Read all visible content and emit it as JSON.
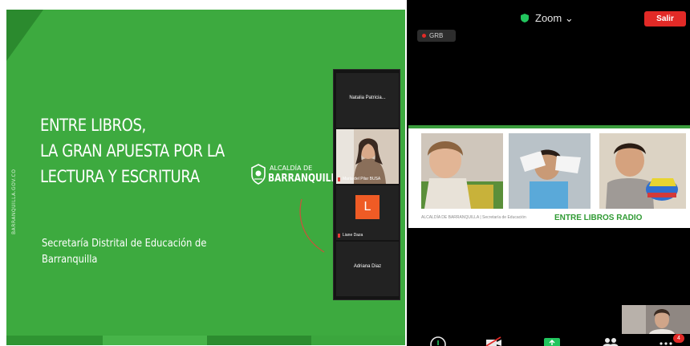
{
  "slide": {
    "vertical_text": "BARRANQUILLA.GOV.CO",
    "title_lines": [
      "ENTRE LIBROS,",
      "LA GRAN APUESTA POR LA",
      "LECTURA Y ESCRITURA"
    ],
    "subtitle_lines": [
      "Secretaría Distrital de Educación de",
      "Barranquilla"
    ],
    "logo_small": "ALCALDÍA DE",
    "logo_big": "BARRANQUILLA",
    "colors": {
      "background": "#3daa3f",
      "corner": "#2b8a2e",
      "text": "#ffffff"
    }
  },
  "participants": {
    "tiles": [
      {
        "name": "Natalia Patricia..."
      },
      {
        "name": "María del Pilar BUSA"
      },
      {
        "name": "Liane Daza",
        "initial": "L"
      },
      {
        "name": "Adriana Diaz"
      }
    ]
  },
  "zoom": {
    "brand": "Zoom",
    "chevron": "⌄",
    "leave_label": "Salir",
    "recording_label": "GRB",
    "share_footer": "ALCALDÍA DE BARRANQUILLA  |  Secretaría de Educación",
    "share_title": "ENTRE LIBROS RADIO",
    "participant_badge": "4",
    "colors": {
      "leave": "#e22a27",
      "accent_green": "#2f9a33",
      "background": "#000000"
    },
    "toolbar_icons": [
      "audio-icon",
      "video-off-icon",
      "share-screen-icon",
      "participants-icon",
      "more-icon"
    ]
  }
}
